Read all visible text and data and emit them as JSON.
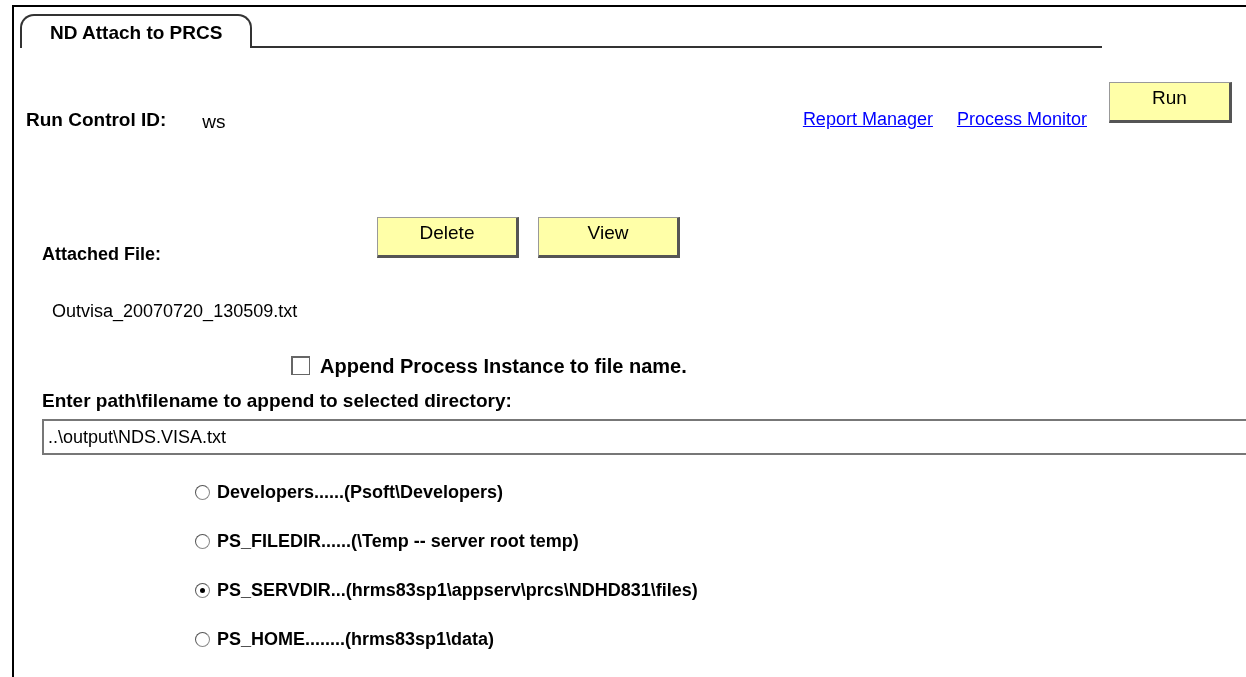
{
  "tab": {
    "label": "ND Attach to PRCS",
    "selected": true
  },
  "run_control": {
    "label": "Run Control ID:",
    "value": "ws"
  },
  "links": [
    "Report Manager",
    "Process Monitor"
  ],
  "run_button": "Run",
  "attached_file": {
    "label": "Attached File:",
    "buttons": [
      "Delete",
      "View"
    ],
    "file_name": "Outvisa_20070720_130509.txt"
  },
  "append_checkbox": {
    "label": "Append Process Instance to file name.",
    "checked": false
  },
  "path_field": {
    "label": "Enter path\\filename to append to selected directory:",
    "value": "..\\output\\NDS.VISA.txt"
  },
  "directories": [
    {
      "label": "Developers......(Psoft\\Developers)",
      "selected": false
    },
    {
      "label": "PS_FILEDIR......(\\Temp -- server root temp)",
      "selected": false
    },
    {
      "label": "PS_SERVDIR...(hrms83sp1\\appserv\\prcs\\NDHD831\\files)",
      "selected": true
    },
    {
      "label": "PS_HOME........(hrms83sp1\\data)",
      "selected": false
    }
  ]
}
